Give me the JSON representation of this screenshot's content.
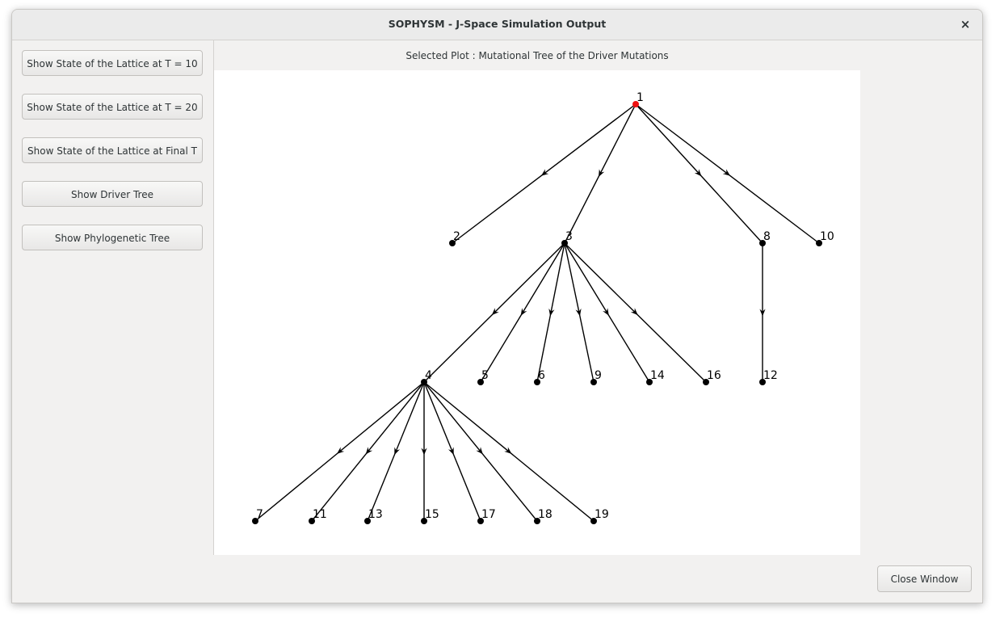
{
  "window": {
    "title": "SOPHYSM - J-Space Simulation Output",
    "close_glyph": "×"
  },
  "sidebar": {
    "buttons": [
      {
        "label": "Show State of the Lattice at T = 10"
      },
      {
        "label": "Show State of the Lattice at T = 20"
      },
      {
        "label": "Show State of the Lattice at Final  T"
      },
      {
        "label": "Show Driver Tree"
      },
      {
        "label": "Show Phylogenetic Tree"
      }
    ]
  },
  "plot": {
    "caption": "Selected Plot : Mutational Tree of the Driver Mutations",
    "root_color": "#ee1111",
    "node_color": "#000000"
  },
  "chart_data": {
    "type": "tree",
    "root": "1",
    "nodes": [
      "1",
      "2",
      "3",
      "8",
      "10",
      "4",
      "5",
      "6",
      "9",
      "14",
      "16",
      "12",
      "7",
      "11",
      "13",
      "15",
      "17",
      "18",
      "19"
    ],
    "edges": [
      [
        "1",
        "2"
      ],
      [
        "1",
        "3"
      ],
      [
        "1",
        "8"
      ],
      [
        "1",
        "10"
      ],
      [
        "3",
        "4"
      ],
      [
        "3",
        "5"
      ],
      [
        "3",
        "6"
      ],
      [
        "3",
        "9"
      ],
      [
        "3",
        "14"
      ],
      [
        "3",
        "16"
      ],
      [
        "8",
        "12"
      ],
      [
        "4",
        "7"
      ],
      [
        "4",
        "11"
      ],
      [
        "4",
        "13"
      ],
      [
        "4",
        "15"
      ],
      [
        "4",
        "17"
      ],
      [
        "4",
        "18"
      ],
      [
        "4",
        "19"
      ]
    ]
  },
  "footer": {
    "close_label": "Close Window"
  }
}
